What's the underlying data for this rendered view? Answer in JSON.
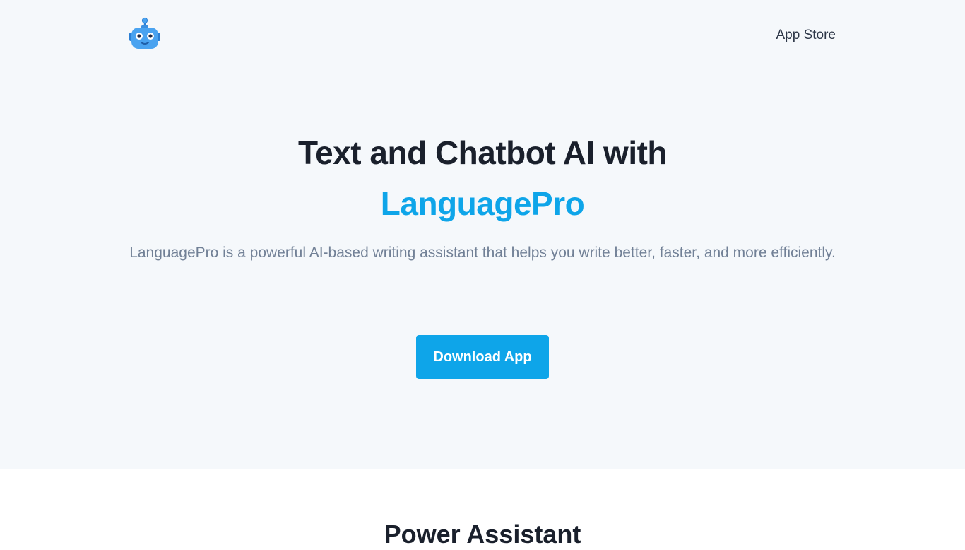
{
  "header": {
    "logo_icon": "robot-icon",
    "nav_link": "App Store"
  },
  "hero": {
    "title": "Text and Chatbot AI with",
    "brand": "LanguagePro",
    "description": "LanguagePro is a powerful AI-based writing assistant that helps you write better, faster, and more efficiently.",
    "cta_label": "Download App"
  },
  "features": {
    "title": "Power Assistant"
  },
  "colors": {
    "accent": "#0ea5e9",
    "hero_background": "#f5f8fb",
    "robot_body": "#4aa3f0"
  }
}
